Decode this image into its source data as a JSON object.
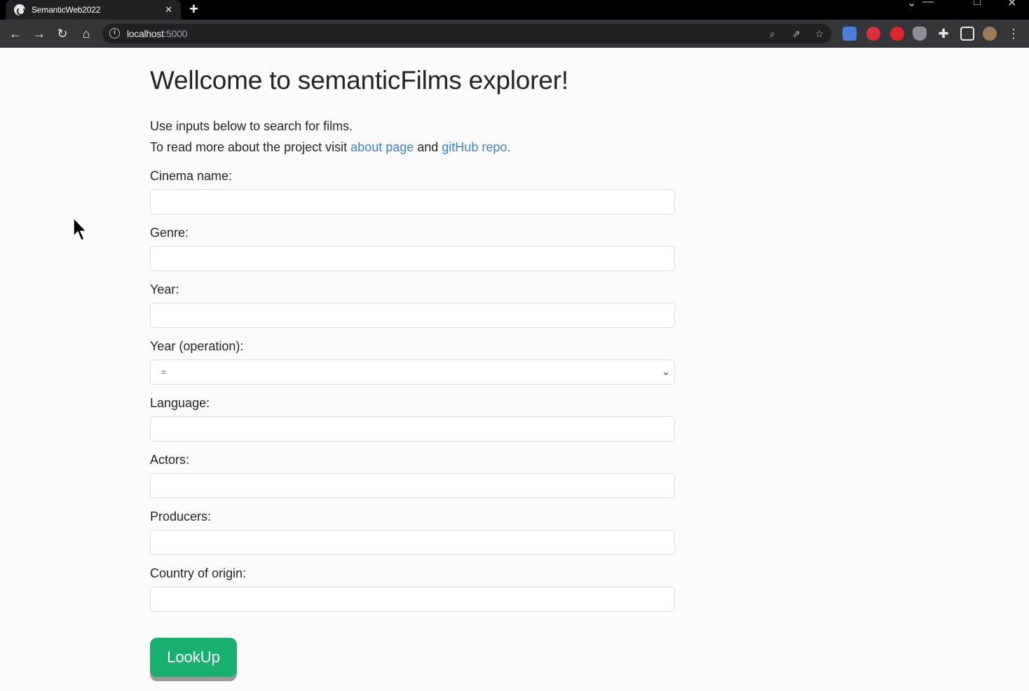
{
  "browser": {
    "tab_title": "SemanticWeb2022",
    "tab_close": "✕",
    "new_tab": "+",
    "url_host": "localhost",
    "url_port": ":5000"
  },
  "page": {
    "heading": "Wellcome to semanticFilms explorer!",
    "intro_line1": "Use inputs below to search for films.",
    "intro_line2_prefix": "To read more about the project visit ",
    "about_link": "about page",
    "intro_and": " and ",
    "github_link": "gitHub repo",
    "intro_end": "."
  },
  "form": {
    "cinema_label": "Cinema name:",
    "genre_label": "Genre:",
    "year_label": "Year:",
    "year_op_label": "Year (operation):",
    "year_op_value": "=",
    "language_label": "Language:",
    "actors_label": "Actors:",
    "producers_label": "Producers:",
    "country_label": "Country of origin:",
    "submit_label": "LookUp"
  },
  "colors": {
    "accent_link": "#3b7fe0",
    "button_green": "#19b070"
  }
}
